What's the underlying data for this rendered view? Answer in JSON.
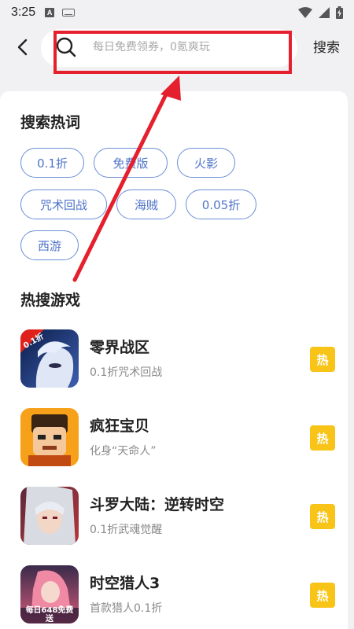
{
  "status": {
    "time": "3:25",
    "a_glyph": "A"
  },
  "top": {
    "search_placeholder": "每日免费领券，0氪爽玩",
    "search_label": "搜索"
  },
  "hot_words": {
    "title": "搜索热词",
    "tags": [
      "0.1折",
      "免费版",
      "火影",
      "咒术回战",
      "海贼",
      "0.05折",
      "西游"
    ]
  },
  "hot_games": {
    "title": "热搜游戏",
    "badge": "热",
    "items": [
      {
        "name": "零界战区",
        "desc": "0.1折咒术回战",
        "icon_text": "0.1折"
      },
      {
        "name": "疯狂宝贝",
        "desc": "化身“天命人”",
        "icon_text": ""
      },
      {
        "name": "斗罗大陆：逆转时空",
        "desc": "0.1折武魂觉醒",
        "icon_text": ""
      },
      {
        "name": "时空猎人3",
        "desc": "首款猎人0.1折",
        "icon_text": "每日648免费送"
      }
    ]
  },
  "colors": {
    "accent": "#4f74c9",
    "highlight": "#e5202e",
    "badge": "#f8c418"
  }
}
